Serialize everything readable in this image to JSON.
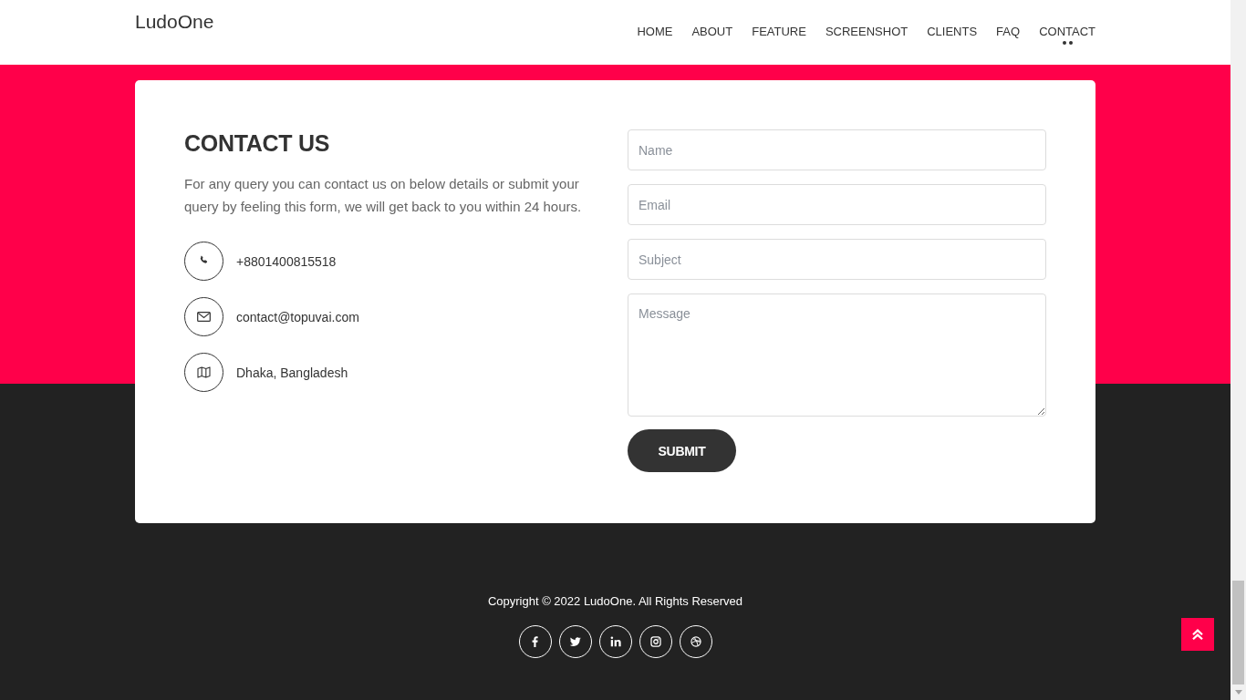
{
  "header": {
    "logo": "LudoOne",
    "nav": [
      {
        "label": "HOME",
        "selected": false
      },
      {
        "label": "ABOUT",
        "selected": false
      },
      {
        "label": "FEATURE",
        "selected": false
      },
      {
        "label": "SCREENSHOT",
        "selected": false
      },
      {
        "label": "CLIENTS",
        "selected": false
      },
      {
        "label": "FAQ",
        "selected": false
      },
      {
        "label": "CONTACT",
        "selected": true
      }
    ]
  },
  "contact": {
    "title": "CONTACT US",
    "intro": "For any query you can contact us on below details or submit your query by feeling this form, we will get back to you within 24 hours.",
    "details": [
      {
        "kind": "phone",
        "text": "+8801400815518"
      },
      {
        "kind": "email",
        "text": "contact@topuvai.com"
      },
      {
        "kind": "address",
        "text": "Dhaka, Bangladesh"
      }
    ],
    "form": {
      "fields": [
        {
          "kind": "line",
          "placeholder": "Name"
        },
        {
          "kind": "line",
          "placeholder": "Email"
        },
        {
          "kind": "line",
          "placeholder": "Subject"
        },
        {
          "kind": "area",
          "placeholder": "Message"
        }
      ],
      "submit": "SUBMIT"
    }
  },
  "footer": {
    "copyright": "Copyright © 2022 LudoOne. All Rights Reserved",
    "social": [
      {
        "kind": "facebook"
      },
      {
        "kind": "twitter"
      },
      {
        "kind": "linkedin"
      },
      {
        "kind": "instagram"
      },
      {
        "kind": "dribbble"
      }
    ]
  }
}
